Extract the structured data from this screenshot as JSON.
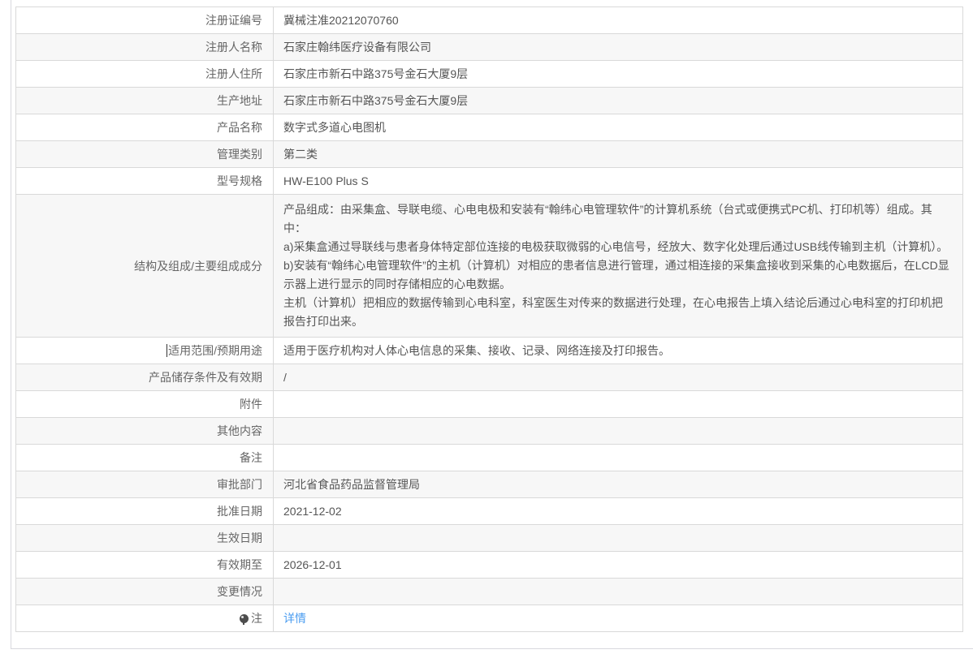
{
  "page": {
    "link_color": "#4a9cf0",
    "alt_row_color": "#f7f7f7",
    "border_color": "#d9d9d9"
  },
  "table": {
    "rows": [
      {
        "label": "注册证编号",
        "value": "冀械注准20212070760"
      },
      {
        "label": "注册人名称",
        "value": "石家庄翰纬医疗设备有限公司"
      },
      {
        "label": "注册人住所",
        "value": "石家庄市新石中路375号金石大厦9层"
      },
      {
        "label": "生产地址",
        "value": "石家庄市新石中路375号金石大厦9层"
      },
      {
        "label": "产品名称",
        "value": "数字式多道心电图机"
      },
      {
        "label": "管理类别",
        "value": "第二类"
      },
      {
        "label": "型号规格",
        "value": "HW-E100 Plus S"
      },
      {
        "label": "结构及组成/主要组成成分",
        "multiline": true,
        "value": "产品组成：由采集盒、导联电缆、心电电极和安装有“翰纬心电管理软件”的计算机系统（台式或便携式PC机、打印机等）组成。其中：\na)采集盒通过导联线与患者身体特定部位连接的电极获取微弱的心电信号，经放大、数字化处理后通过USB线传输到主机（计算机）。\nb)安装有“翰纬心电管理软件”的主机（计算机）对相应的患者信息进行管理，通过相连接的采集盒接收到采集的心电数据后，在LCD显示器上进行显示的同时存储相应的心电数据。\n主机（计算机）把相应的数据传输到心电科室，科室医生对传来的数据进行处理，在心电报告上填入结论后通过心电科室的打印机把报告打印出来。"
      },
      {
        "label": "适用范围/预期用途",
        "caret": true,
        "value": "适用于医疗机构对人体心电信息的采集、接收、记录、网络连接及打印报告。"
      },
      {
        "label": "产品储存条件及有效期",
        "value": "/"
      },
      {
        "label": "附件",
        "value": ""
      },
      {
        "label": "其他内容",
        "value": ""
      },
      {
        "label": "备注",
        "value": ""
      },
      {
        "label": "审批部门",
        "value": "河北省食品药品监督管理局"
      },
      {
        "label": "批准日期",
        "value": "2021-12-02"
      },
      {
        "label": "生效日期",
        "value": ""
      },
      {
        "label": "有效期至",
        "value": "2026-12-01"
      },
      {
        "label": "变更情况",
        "value": ""
      },
      {
        "label": "注",
        "icon": "note",
        "link": true,
        "value": "详情"
      }
    ]
  }
}
